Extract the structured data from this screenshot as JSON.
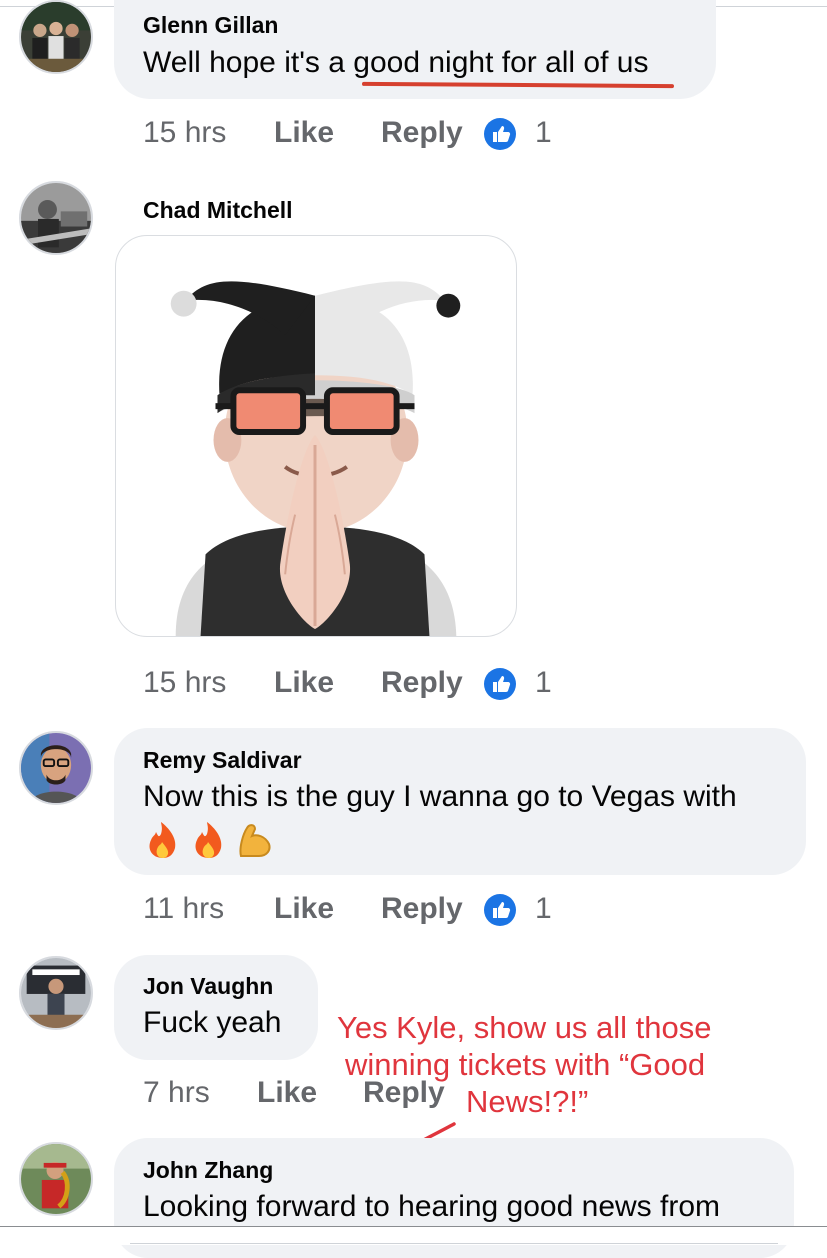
{
  "comments": [
    {
      "name": "Glenn Gillan",
      "text": "Well hope it's a good night for all of us",
      "time": "15 hrs",
      "like_label": "Like",
      "reply_label": "Reply",
      "likes": "1"
    },
    {
      "name": "Chad Mitchell",
      "sticker": "jester-avatar-praying-hands",
      "time": "15 hrs",
      "like_label": "Like",
      "reply_label": "Reply",
      "likes": "1"
    },
    {
      "name": "Remy Saldivar",
      "text": "Now this is the guy I wanna go to Vegas with",
      "emojis": [
        "fire",
        "fire",
        "flexed-biceps"
      ],
      "time": "11 hrs",
      "like_label": "Like",
      "reply_label": "Reply",
      "likes": "1"
    },
    {
      "name": "Jon Vaughn",
      "text": "Fuck yeah",
      "time": "7 hrs",
      "like_label": "Like",
      "reply_label": "Reply"
    },
    {
      "name": "John Zhang",
      "text": "Looking forward to hearing good news from"
    }
  ],
  "annotation": {
    "line1": "Yes Kyle, show us all those",
    "line2": "winning tickets with “Good",
    "line3": "News!?!”",
    "color": "#e0353d"
  },
  "colors": {
    "bubble": "#f0f2f5",
    "secondary_text": "#65676b",
    "like_blue": "#1b74e4"
  }
}
